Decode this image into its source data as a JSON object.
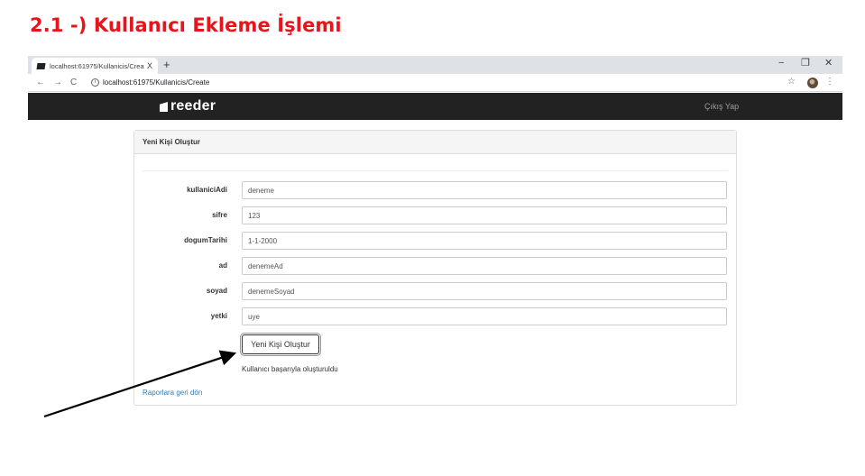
{
  "heading": "2.1 -) Kullanıcı Ekleme İşlemi",
  "browser": {
    "tab_title": "localhost:61975/Kullanicis/Create",
    "tab_close": "X",
    "new_tab": "+",
    "minimize": "−",
    "restore": "❐",
    "close": "✕",
    "back": "←",
    "forward": "→",
    "reload": "C",
    "info": "i",
    "url": "localhost:61975/Kullanicis/Create",
    "star": "☆",
    "menu": "⋮"
  },
  "navbar": {
    "brand": "reeder",
    "logout": "Çıkış Yap"
  },
  "panel": {
    "heading": "Yeni Kişi Oluştur"
  },
  "form": {
    "fields": [
      {
        "label": "kullaniciAdi",
        "value": "deneme"
      },
      {
        "label": "sifre",
        "value": "123"
      },
      {
        "label": "dogumTarihi",
        "value": "1-1-2000"
      },
      {
        "label": "ad",
        "value": "denemeAd"
      },
      {
        "label": "soyad",
        "value": "denemeSoyad"
      },
      {
        "label": "yetki",
        "value": "uye"
      }
    ],
    "submit_label": "Yeni Kişi Oluştur",
    "result_message": "Kullanıcı başarıyla oluşturuldu",
    "back_link": "Raporlara geri dön"
  },
  "colors": {
    "heading": "#e8141b",
    "navbar": "#222222",
    "link": "#337ab7"
  },
  "icons": {
    "favicon": "reeder-favicon-icon",
    "info": "info-circle-icon",
    "star": "star-icon",
    "avatar": "profile-avatar-icon",
    "arrow": "annotation-arrow-icon"
  }
}
